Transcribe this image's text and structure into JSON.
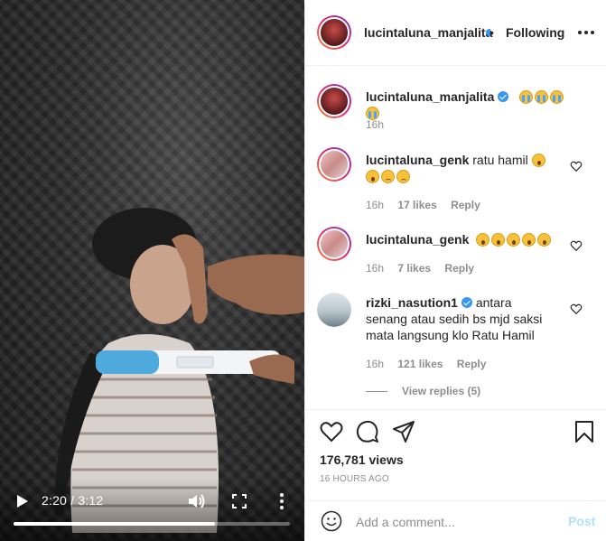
{
  "video": {
    "current_time": "2:20",
    "duration": "3:12",
    "progress_fraction": 0.73
  },
  "header": {
    "username": "lucintaluna_manjalita",
    "separator": "•",
    "follow_label": "Following"
  },
  "caption": {
    "username": "lucintaluna_manjalita",
    "time": "16h"
  },
  "comments": [
    {
      "username": "lucintaluna_genk",
      "text": "ratu hamil",
      "time": "16h",
      "likes": "17 likes",
      "reply": "Reply"
    },
    {
      "username": "lucintaluna_genk",
      "text": "",
      "time": "16h",
      "likes": "7 likes",
      "reply": "Reply"
    },
    {
      "username": "rizki_nasution1",
      "text": "antara senang atau sedih bs mjd saksi mata langsung klo Ratu Hamil",
      "time": "16h",
      "likes": "121 likes",
      "reply": "Reply"
    }
  ],
  "view_replies": "View replies (5)",
  "stats": {
    "views": "176,781 views",
    "ago": "16 HOURS AGO"
  },
  "composer": {
    "placeholder": "Add a comment...",
    "post_label": "Post"
  },
  "colors": {
    "accent": "#3897f0",
    "post_disabled": "#b2dffc",
    "muted": "#8e8e8e"
  }
}
